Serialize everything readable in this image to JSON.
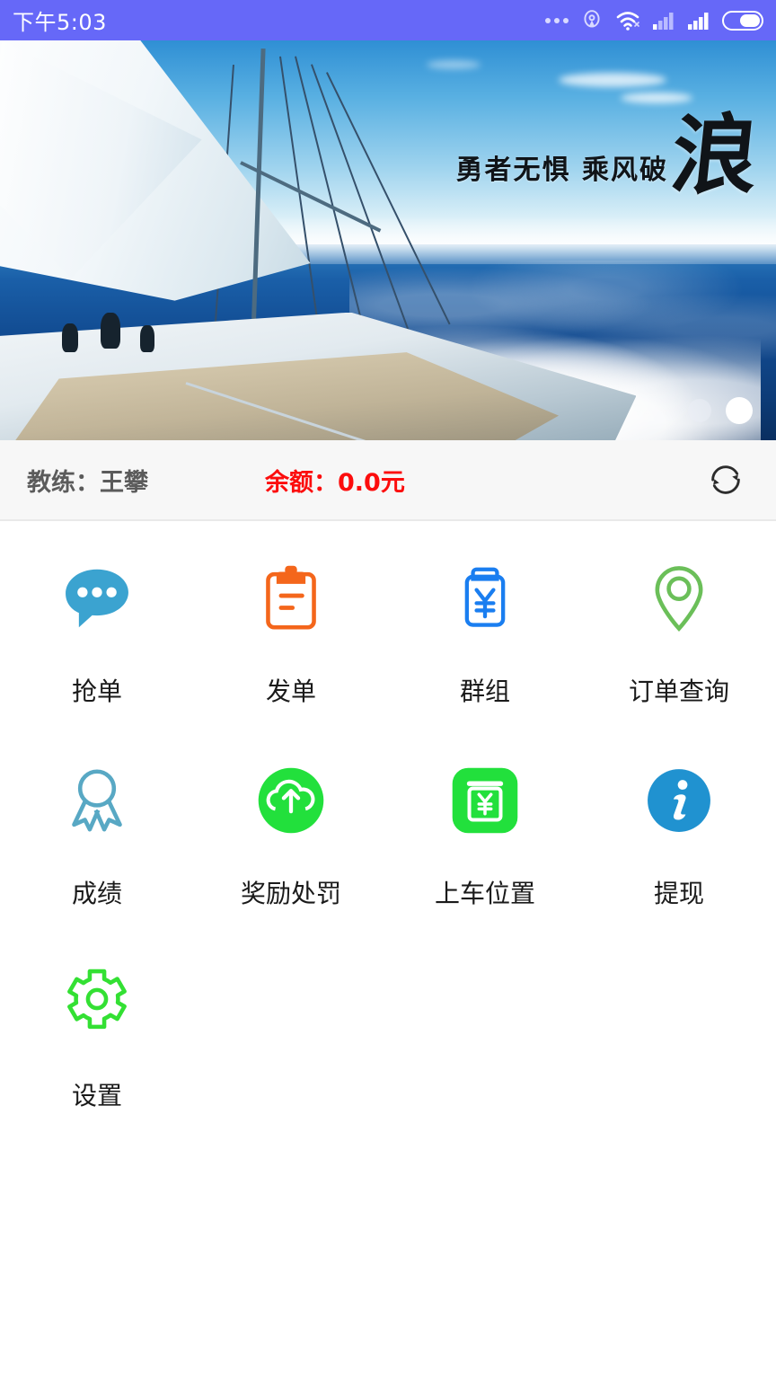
{
  "status_bar": {
    "time": "下午5:03",
    "background": "#6668f8",
    "icons": [
      "more-dots-icon",
      "nfc-icon",
      "wifi-icon",
      "signal-1-icon",
      "signal-2-icon",
      "battery-icon"
    ]
  },
  "banner": {
    "slogan_small": "勇者无惧 乘风破",
    "slogan_big": "浪",
    "image_alt": "sailboat-at-sea",
    "dots": [
      {
        "label": "1",
        "active": false
      },
      {
        "label": "2",
        "active": true
      }
    ]
  },
  "info_bar": {
    "coach": "教练：王攀",
    "balance": "余额：0.0元",
    "balance_color": "#fc0d0d",
    "coach_color": "#5b5b5b",
    "refresh_icon": "refresh-icon"
  },
  "grid": {
    "items": [
      {
        "label": "抢单",
        "icon": "speech-bubble-icon",
        "color": "#3ba3d0"
      },
      {
        "label": "发单",
        "icon": "clipboard-icon",
        "color": "#f4661b"
      },
      {
        "label": "群组",
        "icon": "yuan-clipboard-icon",
        "color": "#1a7ef0"
      },
      {
        "label": "订单查询",
        "icon": "map-pin-icon",
        "color": "#6bbf59"
      },
      {
        "label": "成绩",
        "icon": "award-ribbon-icon",
        "color": "#58a8c4"
      },
      {
        "label": "奖励处罚",
        "icon": "cloud-upload-icon",
        "color": "#22e03c"
      },
      {
        "label": "上车位置",
        "icon": "atm-cash-icon",
        "color": "#22e03c"
      },
      {
        "label": "提现",
        "icon": "info-circle-icon",
        "color": "#2092d0"
      },
      {
        "label": "设置",
        "icon": "gear-icon",
        "color": "#33e033"
      }
    ]
  }
}
